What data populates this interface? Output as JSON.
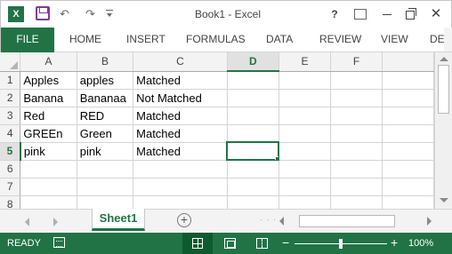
{
  "window": {
    "title": "Book1 - Excel",
    "app_icon_letter": "X",
    "help_label": "?",
    "close_label": "✕"
  },
  "quick_access": {
    "icons": [
      "excel-icon",
      "save-icon",
      "undo-icon",
      "redo-icon",
      "customize-icon"
    ],
    "undo_glyph": "↶",
    "redo_glyph": "↷"
  },
  "ribbon": {
    "tabs": [
      "FILE",
      "HOME",
      "INSERT",
      "FORMULAS",
      "DATA",
      "REVIEW",
      "VIEW",
      "DE"
    ]
  },
  "sheet": {
    "columns": [
      "A",
      "B",
      "C",
      "D",
      "E",
      "F"
    ],
    "active_column": "D",
    "active_row": "5",
    "selected_cell": "D5",
    "rows": [
      {
        "num": "1",
        "cells": [
          "Apples",
          "apples",
          "Matched",
          "",
          "",
          ""
        ]
      },
      {
        "num": "2",
        "cells": [
          "Banana",
          "Bananaa",
          "Not Matched",
          "",
          "",
          ""
        ]
      },
      {
        "num": "3",
        "cells": [
          "Red",
          "RED",
          "Matched",
          "",
          "",
          ""
        ]
      },
      {
        "num": "4",
        "cells": [
          "GREEn",
          "Green",
          "Matched",
          "",
          "",
          ""
        ]
      },
      {
        "num": "5",
        "cells": [
          "pink",
          "pink",
          "Matched",
          "",
          "",
          ""
        ]
      },
      {
        "num": "6",
        "cells": [
          "",
          "",
          "",
          "",
          "",
          ""
        ]
      },
      {
        "num": "7",
        "cells": [
          "",
          "",
          "",
          "",
          "",
          ""
        ]
      },
      {
        "num": "8",
        "cells": [
          "",
          "",
          "",
          "",
          "",
          ""
        ]
      }
    ]
  },
  "sheet_tabs": {
    "active": "Sheet1",
    "add_label": "+",
    "dots": "· · ·"
  },
  "status": {
    "mode": "READY",
    "zoom_out_label": "−",
    "zoom_in_label": "+",
    "zoom": "100%",
    "zoom_fraction": 0.5
  },
  "colors": {
    "accent": "#217346",
    "status_bg": "#217346",
    "header_bg": "#f3f3f3",
    "gridline": "#d4d4d4"
  }
}
